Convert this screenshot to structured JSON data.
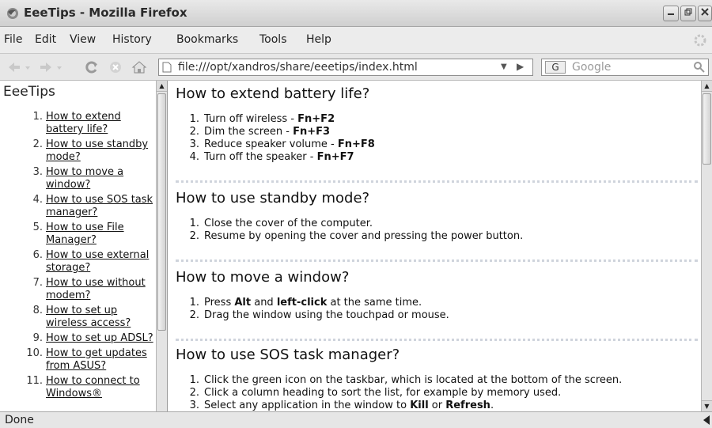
{
  "window": {
    "title": "EeeTips - Mozilla Firefox"
  },
  "menubar": {
    "items": [
      {
        "label": "File"
      },
      {
        "label": "Edit"
      },
      {
        "label": "View"
      },
      {
        "label": "History"
      },
      {
        "label": "Bookmarks"
      },
      {
        "label": "Tools"
      },
      {
        "label": "Help"
      }
    ]
  },
  "navbar": {
    "url": "file:///opt/xandros/share/eeetips/index.html",
    "search_engine": "G",
    "search_placeholder": "Google"
  },
  "sidebar": {
    "title": "EeeTips",
    "items": [
      {
        "num": "1.",
        "label": "How to extend battery life?"
      },
      {
        "num": "2.",
        "label": "How to use standby mode?"
      },
      {
        "num": "3.",
        "label": "How to move a window?"
      },
      {
        "num": "4.",
        "label": "How to use SOS task manager?"
      },
      {
        "num": "5.",
        "label": "How to use File Manager?"
      },
      {
        "num": "6.",
        "label": "How to use external storage?"
      },
      {
        "num": "7.",
        "label": "How to use without modem?"
      },
      {
        "num": "8.",
        "label": "How to set up wireless access?"
      },
      {
        "num": "9.",
        "label": "How to set up ADSL?"
      },
      {
        "num": "10.",
        "label": "How to get updates from ASUS?"
      },
      {
        "num": "11.",
        "label": "How to connect to Windows®"
      }
    ]
  },
  "content": {
    "sections": [
      {
        "heading": "How to extend battery life?",
        "steps": [
          {
            "num": "1.",
            "text": "Turn off wireless - ",
            "key": "Fn+F2"
          },
          {
            "num": "2.",
            "text": "Dim the screen - ",
            "key": "Fn+F3"
          },
          {
            "num": "3.",
            "text": "Reduce speaker volume - ",
            "key": "Fn+F8"
          },
          {
            "num": "4.",
            "text": "Turn off the speaker - ",
            "key": "Fn+F7"
          }
        ]
      },
      {
        "heading": "How to use standby mode?",
        "steps": [
          {
            "num": "1.",
            "text": "Close the cover of the computer."
          },
          {
            "num": "2.",
            "text": "Resume by opening the cover and pressing the power button."
          }
        ]
      },
      {
        "heading": "How to move a window?",
        "steps": [
          {
            "num": "1.",
            "pre": "Press ",
            "b1": "Alt",
            "mid": " and ",
            "b2": "left-click",
            "post": " at the same time."
          },
          {
            "num": "2.",
            "text": "Drag the window using the touchpad or mouse."
          }
        ]
      },
      {
        "heading": "How to use SOS task manager?",
        "steps": [
          {
            "num": "1.",
            "text": "Click the green icon on the taskbar, which is located at the bottom of the screen."
          },
          {
            "num": "2.",
            "text": "Click a column heading to sort the list, for example by memory used."
          },
          {
            "num": "3.",
            "pre": "Select any application in the window to ",
            "b1": "Kill",
            "mid": " or ",
            "b2": "Refresh",
            "post": "."
          }
        ]
      }
    ]
  },
  "statusbar": {
    "text": "Done"
  }
}
